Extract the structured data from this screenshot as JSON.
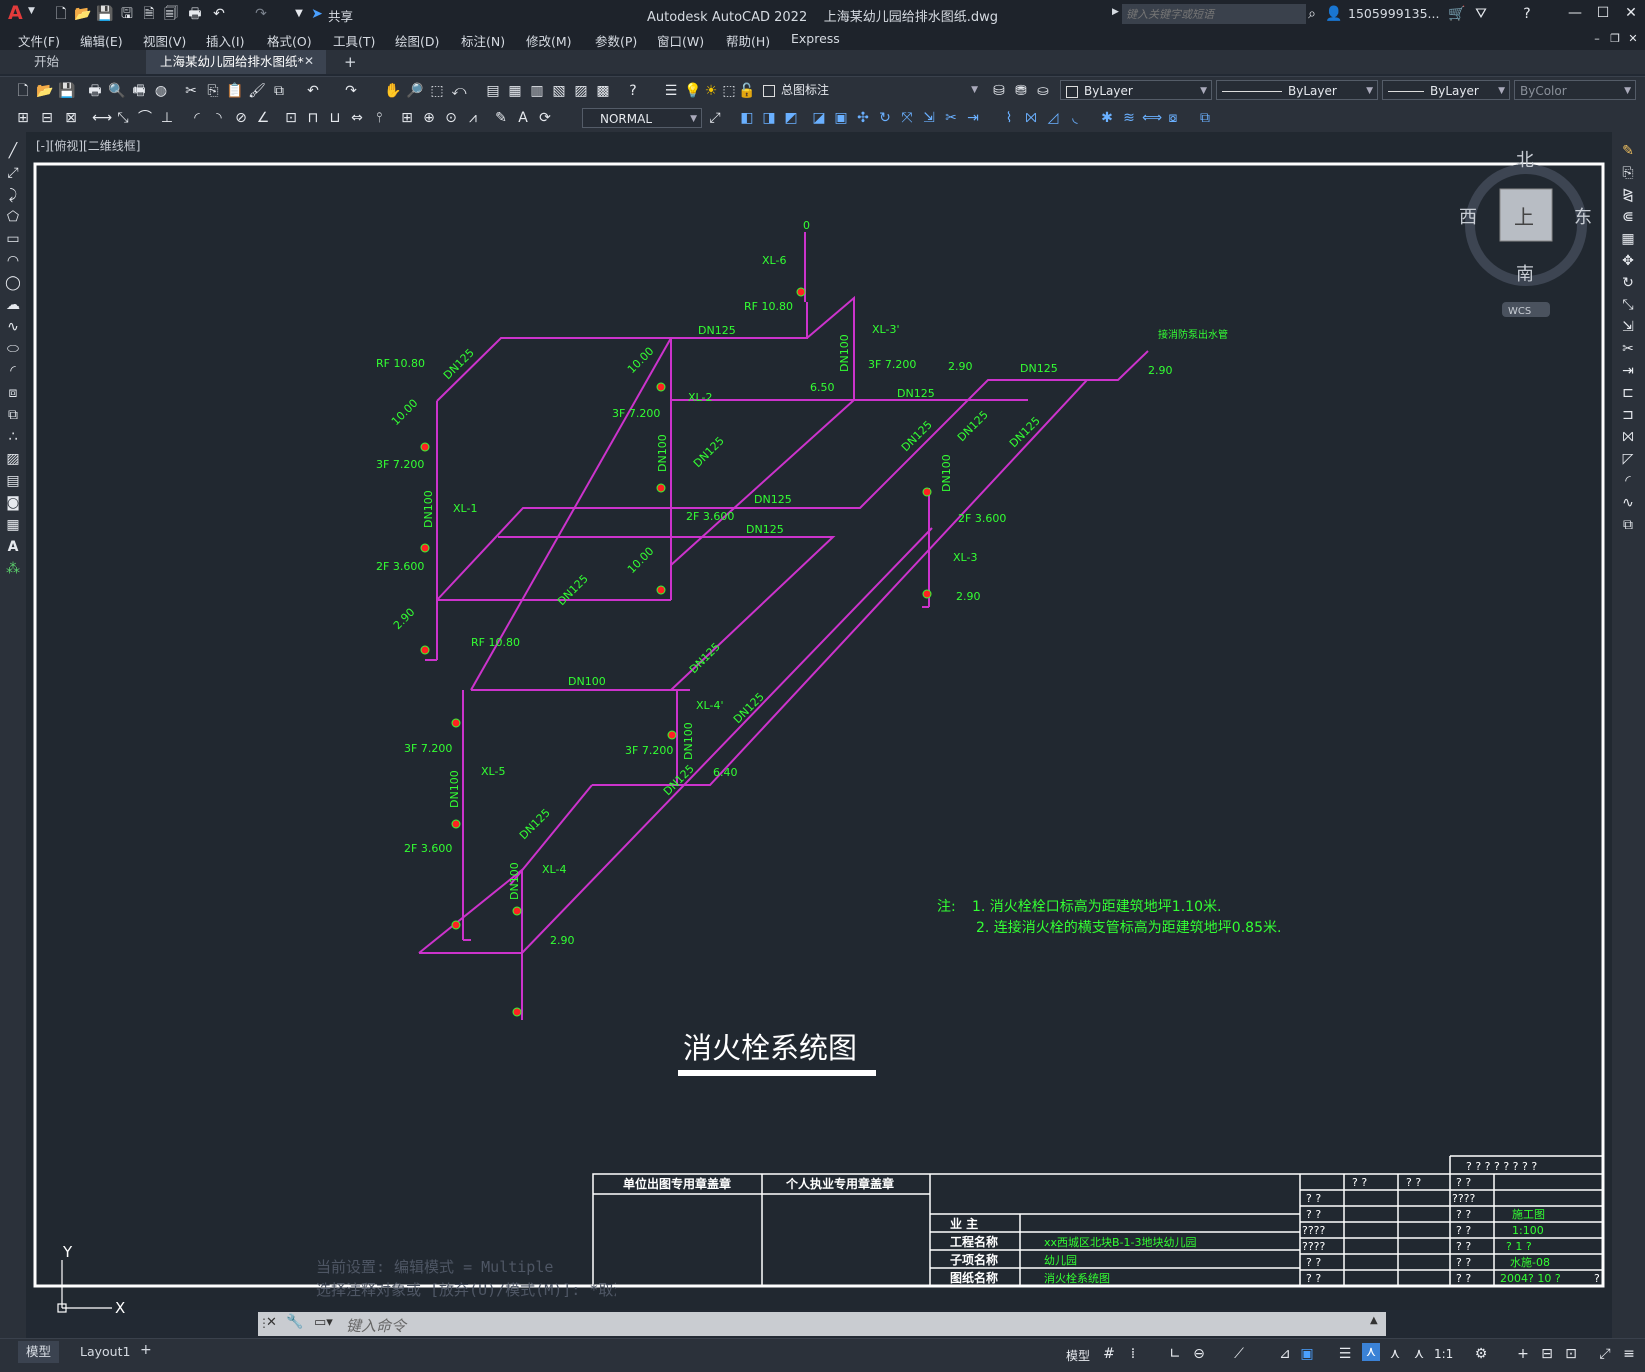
{
  "app": {
    "title": "Autodesk AutoCAD 2022    上海某幼儿园给排水图纸.dwg",
    "logo": "A",
    "share_label": "共享",
    "search_placeholder": "键入关键字或短语",
    "user": "1505999135...",
    "colors": {
      "chrome": "#2b313a",
      "canvas": "#212830",
      "pipe": "#cc33cc",
      "annotation": "#33ff33",
      "accent": "#3b82d6"
    }
  },
  "menu": [
    "文件(F)",
    "编辑(E)",
    "视图(V)",
    "插入(I)",
    "格式(O)",
    "工具(T)",
    "绘图(D)",
    "标注(N)",
    "修改(M)",
    "参数(P)",
    "窗口(W)",
    "帮助(H)",
    "Express"
  ],
  "tabs": {
    "start": "开始",
    "active": "上海某幼儿园给排水图纸*",
    "add": "+"
  },
  "toolbar": {
    "layer_value": "总图标注",
    "color_value": "ByLayer",
    "linetype_value": "ByLayer",
    "lineweight_value": "ByLayer",
    "plotstyle_value": "ByColor",
    "textstyle_value": "NORMAL"
  },
  "viewport_label": "[-][俯视][二维线框]",
  "viewcube": {
    "north": "北",
    "south": "南",
    "east": "东",
    "west": "西",
    "face": "上",
    "wcs": "WCS"
  },
  "drawing": {
    "title": "消火栓系统图",
    "notes": {
      "prefix": "注:",
      "line1": "1. 消火栓栓口标高为距建筑地坪1.10米.",
      "line2": "2. 连接消火栓的横支管标高为距建筑地坪0.85米."
    },
    "labels": {
      "xl6": "XL-6",
      "rf1": "RF 10.80",
      "xl3p": "XL-3'",
      "dn100a": "DN100",
      "dn125a": "DN125",
      "f3a": "3F 7.200",
      "v290a": "2.90",
      "dn125b": "DN125",
      "v650": "6.50",
      "dn125c": "DN125",
      "pump": "接消防泵出水管",
      "v290b": "2.90",
      "rf2": "RF 10.80",
      "dn125d": "DN125",
      "v1000a": "10.00",
      "v1000b": "10.00",
      "xl2": "XL-2",
      "f3b": "3F 7.200",
      "dn100b": "DN100",
      "dn125e": "DN125",
      "f3c": "3F 7.200",
      "xl1": "XL-1",
      "dn100c": "DN100",
      "dn125f": "DN125",
      "dn125g": "DN125",
      "dn125h": "DN125",
      "dn100d": "DN100",
      "f2a": "2F 3.600",
      "xl3": "XL-3",
      "v290c": "2.90",
      "dn125i": "DN125",
      "f2b": "2F 3.600",
      "dn125j": "DN125",
      "f2c": "2F 3.600",
      "v1000c": "10.00",
      "dn125k": "DN125",
      "v290d": "2.90",
      "rf3": "RF 10.80",
      "dn125l": "DN125",
      "dn100e": "DN100",
      "xl4p": "XL-4'",
      "dn125m": "DN125",
      "f3d": "3F 7.200",
      "xl5": "XL-5",
      "dn100f": "DN100",
      "f3e": "3F 7.200",
      "dn100g": "DN100",
      "dn125n": "DN125",
      "v640": "6.40",
      "dn125o": "DN125",
      "f2d": "2F 3.600",
      "xl4": "XL-4",
      "dn100h": "DN100",
      "v290e": "2.90",
      "v0": "0"
    }
  },
  "titleblock": {
    "stamp1": "单位出图专用章盖章",
    "stamp2": "个人执业专用章盖章",
    "owner_label": "业    主",
    "project_label": "工程名称",
    "project_value": "xx西城区北块B-1-3地块幼儿园",
    "sub_label": "子项名称",
    "sub_value": "幼儿园",
    "sheet_label": "图纸名称",
    "sheet_value": "消火栓系统图",
    "q8": "? ? ? ? ? ? ? ?",
    "q2": "? ?",
    "q4": "????",
    "stage": "施工图",
    "scale": "1:100",
    "page": "? 1 ?",
    "drawno": "水施-08",
    "date": "2004? 10 ?",
    "q1": "?"
  },
  "command": {
    "history1": "当前设置: 编辑模式 = Multiple",
    "history2": "选择注释对象或 [放弃(U)/模式(M)]: *取消*",
    "placeholder": "键入命令"
  },
  "ucs": {
    "x": "X",
    "y": "Y"
  },
  "status": {
    "tab_model": "模型",
    "tab_layout": "Layout1",
    "tab_add": "+",
    "model_btn": "模型",
    "scale": "1:1"
  }
}
